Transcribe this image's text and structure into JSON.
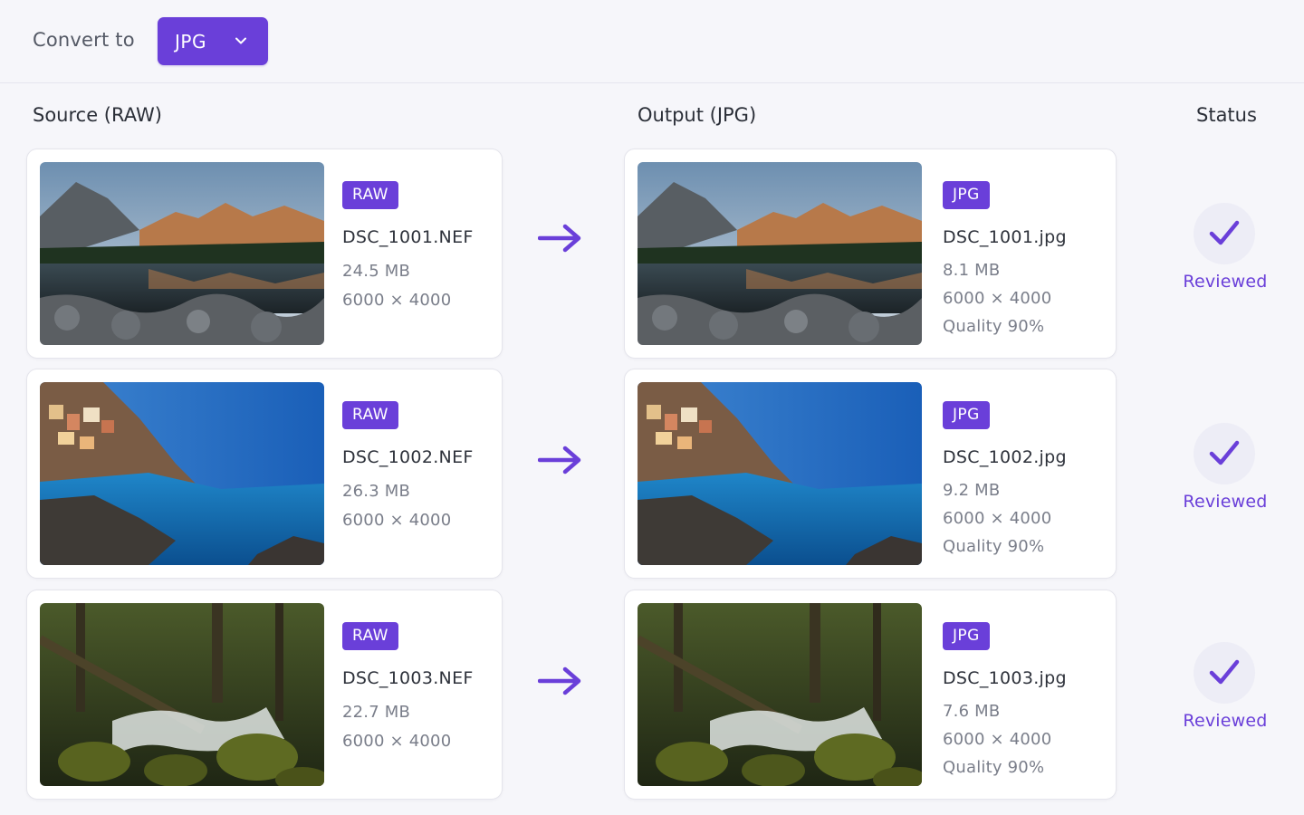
{
  "toolbar": {
    "convert_label": "Convert to",
    "format_value": "JPG"
  },
  "columns": {
    "source": "Source (RAW)",
    "output": "Output (JPG)",
    "status": "Status"
  },
  "icons": {
    "dropdown": "chevron-down-icon",
    "arrow": "arrow-right-icon",
    "check": "check-icon"
  },
  "colors": {
    "accent": "#6a3fd9",
    "status_circle": "#ededf6"
  },
  "rows": [
    {
      "source": {
        "badge": "RAW",
        "filename": "DSC_1001.NEF",
        "size": "24.5 MB",
        "dimensions": "6000 × 4000",
        "image": "mountain-lake-photo"
      },
      "output": {
        "badge": "JPG",
        "filename": "DSC_1001.jpg",
        "size": "8.1 MB",
        "dimensions": "6000 × 4000",
        "quality": "Quality 90%",
        "image": "mountain-lake-photo"
      },
      "status": "Reviewed"
    },
    {
      "source": {
        "badge": "RAW",
        "filename": "DSC_1002.NEF",
        "size": "26.3 MB",
        "dimensions": "6000 × 4000",
        "image": "coastal-village-photo"
      },
      "output": {
        "badge": "JPG",
        "filename": "DSC_1002.jpg",
        "size": "9.2 MB",
        "dimensions": "6000 × 4000",
        "quality": "Quality 90%",
        "image": "coastal-village-photo"
      },
      "status": "Reviewed"
    },
    {
      "source": {
        "badge": "RAW",
        "filename": "DSC_1003.NEF",
        "size": "22.7 MB",
        "dimensions": "6000 × 4000",
        "image": "forest-stream-photo"
      },
      "output": {
        "badge": "JPG",
        "filename": "DSC_1003.jpg",
        "size": "7.6 MB",
        "dimensions": "6000 × 4000",
        "quality": "Quality 90%",
        "image": "forest-stream-photo"
      },
      "status": "Reviewed"
    }
  ]
}
